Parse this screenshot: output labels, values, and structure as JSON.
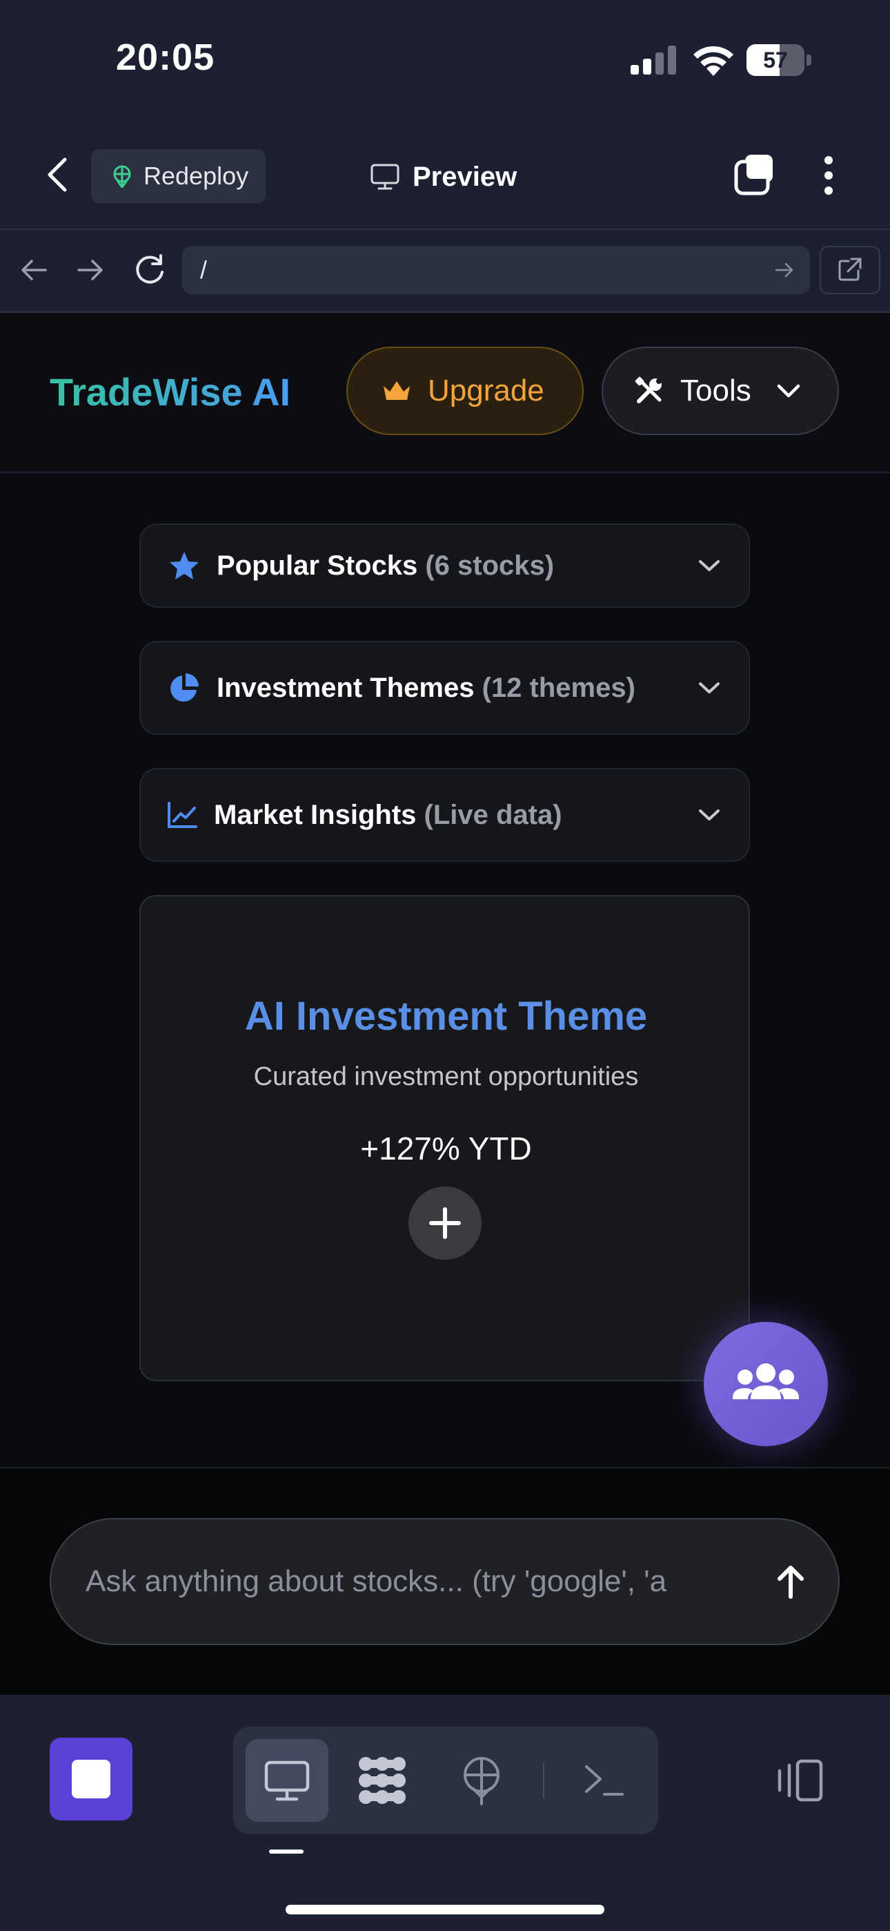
{
  "status_bar": {
    "time": "20:05",
    "battery_level": "57",
    "battery_fraction": 0.57,
    "icons": [
      "signal-icon",
      "wifi-icon",
      "battery-icon"
    ]
  },
  "top_nav": {
    "back_icon": "chevron-left-icon",
    "redeploy_label": "Redeploy",
    "preview_label": "Preview",
    "icons": [
      "deploy-icon",
      "monitor-icon",
      "tabs-icon",
      "more-vertical-icon"
    ]
  },
  "url_bar": {
    "url": "/",
    "icons": [
      "arrow-left-icon",
      "arrow-right-icon",
      "reload-icon",
      "go-arrow-icon",
      "external-link-icon"
    ]
  },
  "app_header": {
    "brand": "TradeWise AI",
    "upgrade_label": "Upgrade",
    "tools_label": "Tools",
    "brand_gradient": [
      "#38c2a0",
      "#4a9cf0"
    ],
    "upgrade_color": "#f5a43b"
  },
  "sections": [
    {
      "title": "Popular Stocks",
      "subtitle": "(6 stocks)",
      "icon": "star-icon"
    },
    {
      "title": "Investment Themes",
      "subtitle": "(12 themes)",
      "icon": "pie-chart-icon"
    },
    {
      "title": "Market Insights",
      "subtitle": "(Live data)",
      "icon": "line-chart-icon"
    }
  ],
  "theme_card": {
    "title": "AI Investment Theme",
    "subtitle": "Curated investment opportunities",
    "performance": "+127% YTD",
    "accent": "#5b8fe6"
  },
  "fab": {
    "icon": "users-icon",
    "color": "#7565dc"
  },
  "chat": {
    "placeholder": "Ask anything about stocks... (try 'google', 'a",
    "send_icon": "arrow-up-icon"
  },
  "bottom_bar": {
    "stop_icon": "stop-icon",
    "segments": [
      "monitor-icon",
      "integrations-icon",
      "deploy-icon",
      "terminal-icon"
    ],
    "active_segment": "monitor-icon",
    "device_icon": "device-toggle-icon",
    "accent": "#5b40d6"
  }
}
